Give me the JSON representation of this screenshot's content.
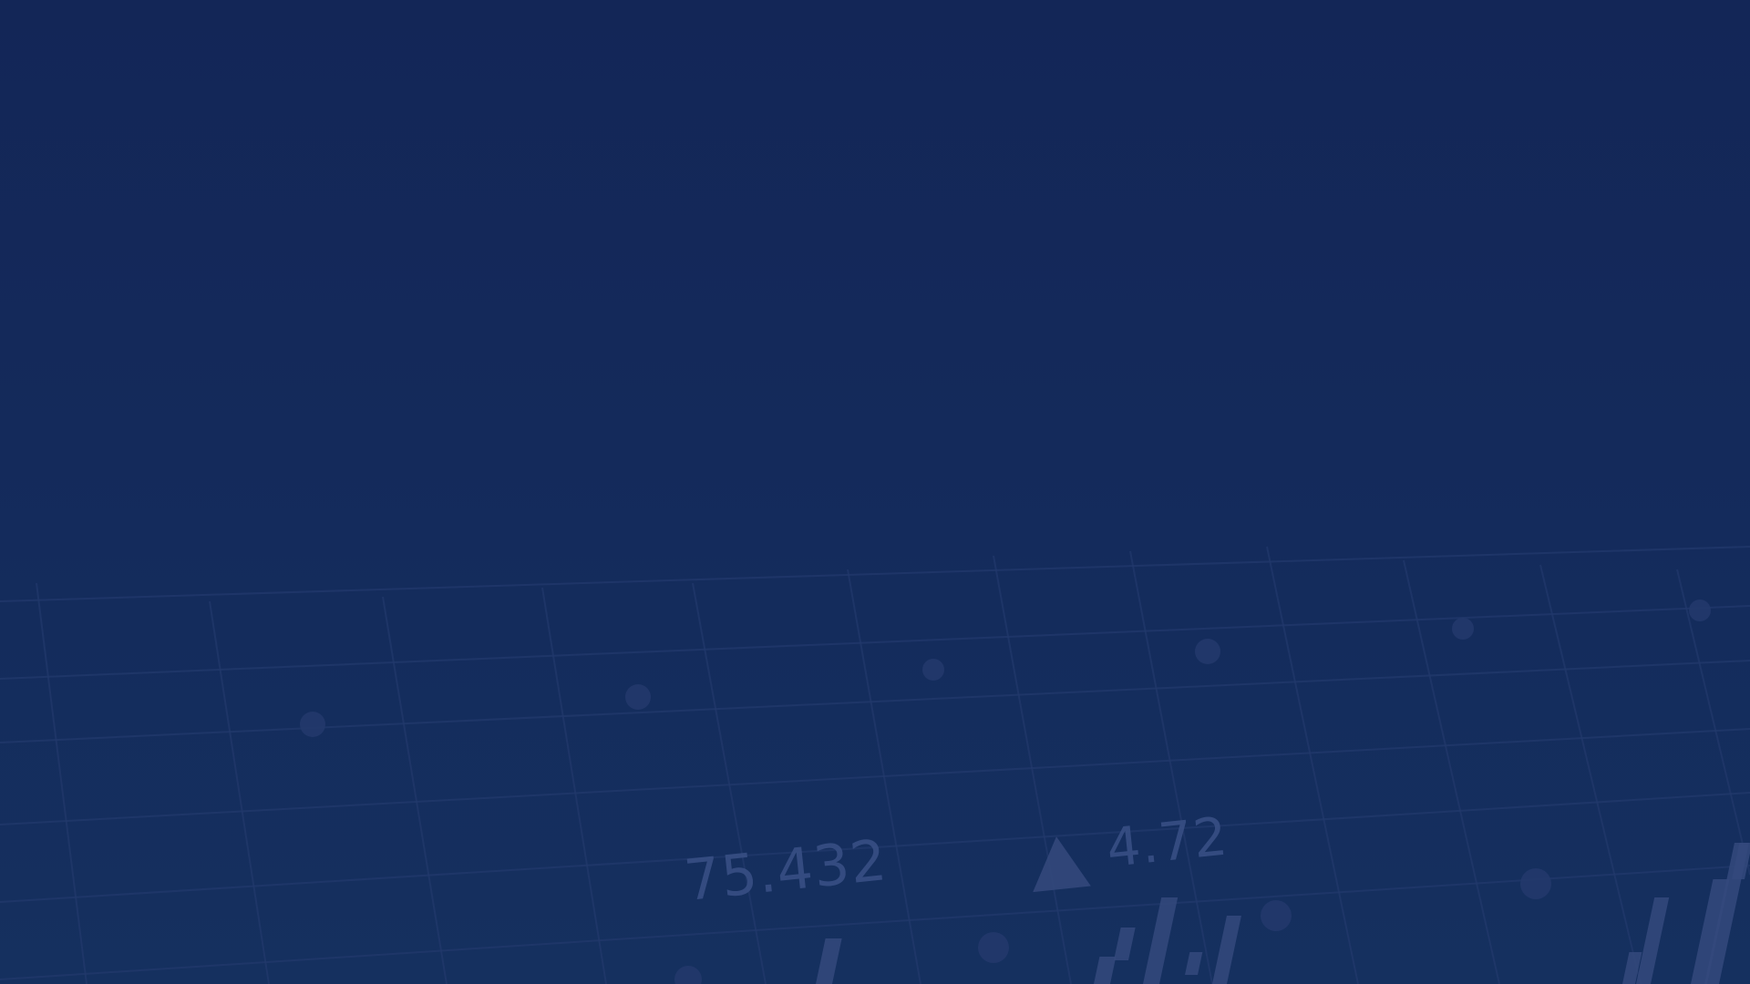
{
  "background": {
    "base_color": "#13295a",
    "grid_color": "#22396c",
    "mark_color": "#34497c"
  },
  "ticker": {
    "main_value": "75.432",
    "change_value": "4.72",
    "change_icon": "up-triangle-icon"
  }
}
